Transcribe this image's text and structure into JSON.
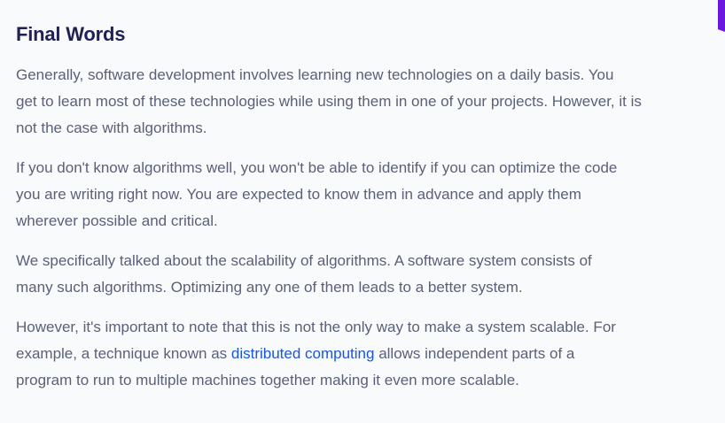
{
  "accent_color": "#6a16e0",
  "heading": "Final Words",
  "paragraphs": [
    {
      "lines": [
        "Generally, software development involves learning new technologies on a daily basis. You",
        "get to learn most of these technologies while using them in one of your projects. However, it is",
        "not the case with algorithms."
      ]
    },
    {
      "lines": [
        "If you don't know algorithms well, you won't be able to identify if you can optimize the code",
        "you are writing right now. You are expected to know them in advance and apply them",
        "wherever possible and critical."
      ]
    },
    {
      "lines": [
        "We specifically talked about the scalability of algorithms. A software system consists of",
        "many such algorithms. Optimizing any one of them leads to a better system."
      ]
    },
    {
      "line1": "However, it's important to note that this is not the only way to make a system scalable. For",
      "line2_before": "example, a technique known as ",
      "link": "distributed computing",
      "line2_after": " allows independent parts of a",
      "line3": "program to run to multiple machines together making it even more scalable."
    }
  ]
}
